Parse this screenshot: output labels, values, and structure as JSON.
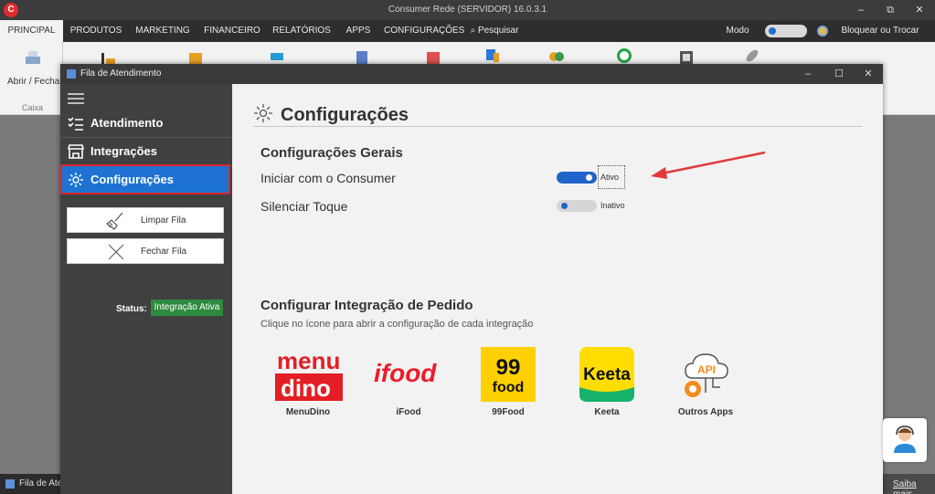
{
  "app": {
    "title": "Consumer Rede (SERVIDOR) 16.0.3.1",
    "logo_letter": "C",
    "minimize": "–",
    "restore": "⧉",
    "close": "✕"
  },
  "menu": {
    "items": [
      "PRINCIPAL",
      "PRODUTOS",
      "MARKETING",
      "FINANCEIRO",
      "RELATÓRIOS",
      "APPS",
      "CONFIGURAÇÕES"
    ],
    "search": "Pesquisar",
    "dark_mode": "Modo Escuro",
    "lock": "Bloquear ou Trocar Usuário"
  },
  "ribbon": {
    "caixa_label": "Abrir / Fechar",
    "caixa_group": "Caixa"
  },
  "window": {
    "title": "Fila de Atendimento",
    "minimize": "–",
    "maximize": "☐",
    "close": "✕"
  },
  "sidebar": {
    "items": [
      {
        "label": "Atendimento",
        "icon": "list-check-icon"
      },
      {
        "label": "Integrações",
        "icon": "store-icon"
      },
      {
        "label": "Configurações",
        "icon": "gear-icon"
      }
    ],
    "buttons": [
      {
        "label": "Limpar Fila",
        "icon": "broom-icon"
      },
      {
        "label": "Fechar Fila",
        "icon": "close-x-icon"
      }
    ],
    "status_label": "Status:",
    "status_value": "Integração Ativa",
    "status_color": "#2e8a3f"
  },
  "content": {
    "title": "Configurações",
    "general_title": "Configurações Gerais",
    "settings": [
      {
        "label": "Iniciar com o Consumer",
        "state": "Ativo",
        "on": true
      },
      {
        "label": "Silenciar Toque",
        "state": "Inativo",
        "on": false
      }
    ],
    "integration_title": "Configurar Integração de Pedido",
    "integration_sub": "Clique no ícone para abrir a configuração de cada integração",
    "integrations": [
      {
        "name": "MenuDino",
        "logo_top": "menu",
        "logo_bottom": "dino"
      },
      {
        "name": "iFood",
        "logo_text": "ifood"
      },
      {
        "name": "99Food",
        "logo_top": "99",
        "logo_bottom": "food"
      },
      {
        "name": "Keeta",
        "logo_text": "Keeta"
      },
      {
        "name": "Outros Apps",
        "logo_text": "API"
      }
    ]
  },
  "footer": {
    "taskbar": "Fila de Atendimento",
    "saiba": "Saiba mais"
  },
  "colors": {
    "accent": "#1e73d2",
    "highlight_border": "#d9262c",
    "annotation_arrow": "#e03a3a"
  }
}
